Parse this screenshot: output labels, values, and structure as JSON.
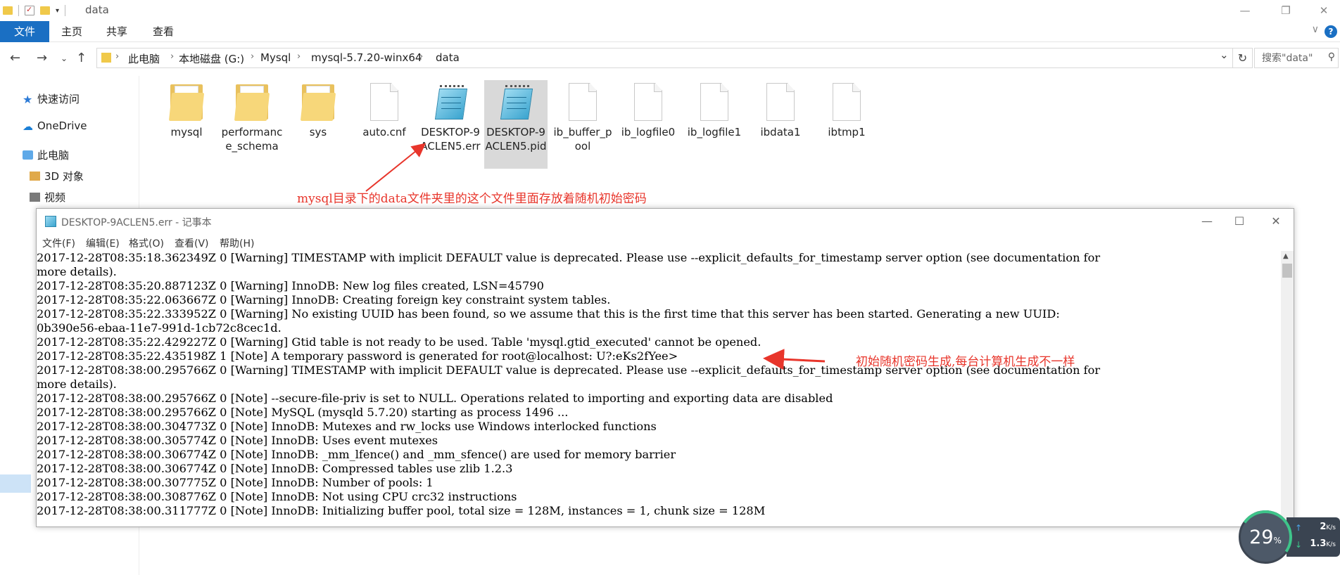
{
  "window": {
    "title": "data",
    "minimize": "—",
    "maximize": "❐",
    "close": "✕"
  },
  "ribbon": {
    "tabs": [
      "文件",
      "主页",
      "共享",
      "查看"
    ],
    "help": "?",
    "collapse": "∨"
  },
  "address": {
    "crumbs": [
      "此电脑",
      "本地磁盘 (G:)",
      "Mysql",
      "mysql-5.7.20-winx64",
      "data"
    ],
    "separator": "›",
    "search_placeholder": "搜索\"data\""
  },
  "nav_pane": {
    "quick_access": "快速访问",
    "onedrive": "OneDrive",
    "this_pc": "此电脑",
    "objects_3d": "3D 对象",
    "videos": "视频"
  },
  "files": [
    {
      "name": "mysql",
      "type": "folder"
    },
    {
      "name": "performance_schema",
      "type": "folder"
    },
    {
      "name": "sys",
      "type": "folder"
    },
    {
      "name": "auto.cnf",
      "type": "file"
    },
    {
      "name": "DESKTOP-9ACLEN5.err",
      "type": "notepad"
    },
    {
      "name": "DESKTOP-9ACLEN5.pid",
      "type": "notepad"
    },
    {
      "name": "ib_buffer_pool",
      "type": "file"
    },
    {
      "name": "ib_logfile0",
      "type": "file"
    },
    {
      "name": "ib_logfile1",
      "type": "file"
    },
    {
      "name": "ibdata1",
      "type": "file"
    },
    {
      "name": "ibtmp1",
      "type": "file"
    }
  ],
  "file_labels": {
    "f0": "mysql",
    "f1": "performance_schema",
    "f2": "sys",
    "f3": "auto.cnf",
    "f4": "DESKTOP-9ACLEN5.err",
    "f5": "DESKTOP-9ACLEN5.pid",
    "f6": "ib_buffer_pool",
    "f7": "ib_logfile0",
    "f8": "ib_logfile1",
    "f9": "ibdata1",
    "f10": "ibtmp1"
  },
  "annotations": {
    "top": "mysql目录下的data文件夹里的这个文件里面存放着随机初始密码",
    "password": "初始随机密码生成,每台计算机生成不一样"
  },
  "notepad": {
    "title": "DESKTOP-9ACLEN5.err - 记事本",
    "menu": [
      "文件(F)",
      "编辑(E)",
      "格式(O)",
      "查看(V)",
      "帮助(H)"
    ],
    "lines": [
      "2017-12-28T08:35:18.362349Z 0 [Warning] TIMESTAMP with implicit DEFAULT value is deprecated. Please use --explicit_defaults_for_timestamp server option (see documentation for",
      "more details).",
      "2017-12-28T08:35:20.887123Z 0 [Warning] InnoDB: New log files created, LSN=45790",
      "2017-12-28T08:35:22.063667Z 0 [Warning] InnoDB: Creating foreign key constraint system tables.",
      "2017-12-28T08:35:22.333952Z 0 [Warning] No existing UUID has been found, so we assume that this is the first time that this server has been started. Generating a new UUID:",
      "0b390e56-ebaa-11e7-991d-1cb72c8cec1d.",
      "2017-12-28T08:35:22.429227Z 0 [Warning] Gtid table is not ready to be used. Table 'mysql.gtid_executed' cannot be opened.",
      "2017-12-28T08:35:22.435198Z 1 [Note] A temporary password is generated for root@localhost: U?:eKs2fYee>",
      "2017-12-28T08:38:00.295766Z 0 [Warning] TIMESTAMP with implicit DEFAULT value is deprecated. Please use --explicit_defaults_for_timestamp server option (see documentation for",
      "more details).",
      "2017-12-28T08:38:00.295766Z 0 [Note] --secure-file-priv is set to NULL. Operations related to importing and exporting data are disabled",
      "2017-12-28T08:38:00.295766Z 0 [Note] MySQL (mysqld 5.7.20) starting as process 1496 ...",
      "2017-12-28T08:38:00.304773Z 0 [Note] InnoDB: Mutexes and rw_locks use Windows interlocked functions",
      "2017-12-28T08:38:00.305774Z 0 [Note] InnoDB: Uses event mutexes",
      "2017-12-28T08:38:00.306774Z 0 [Note] InnoDB: _mm_lfence() and _mm_sfence() are used for memory barrier",
      "2017-12-28T08:38:00.306774Z 0 [Note] InnoDB: Compressed tables use zlib 1.2.3",
      "2017-12-28T08:38:00.307775Z 0 [Note] InnoDB: Number of pools: 1",
      "2017-12-28T08:38:00.308776Z 0 [Note] InnoDB: Not using CPU crc32 instructions",
      "2017-12-28T08:38:00.311777Z 0 [Note] InnoDB: Initializing buffer pool, total size = 128M, instances = 1, chunk size = 128M"
    ]
  },
  "net_widget": {
    "cpu_percent": "29",
    "percent_sign": "%",
    "upload": "2",
    "download": "1.3",
    "unit": "K/s"
  },
  "colors": {
    "accent": "#1a6fc3",
    "annotation": "#e8352b"
  }
}
